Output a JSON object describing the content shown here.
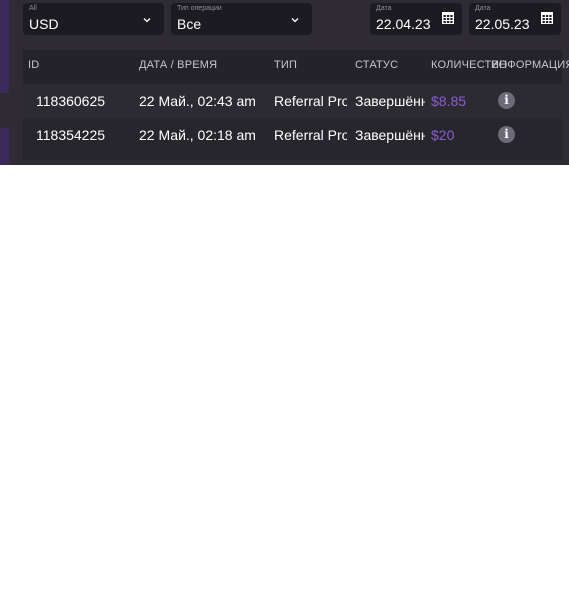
{
  "filters": {
    "currency": {
      "label": "All",
      "value": "USD"
    },
    "operation_type": {
      "label": "Тип операции",
      "value": "Все"
    },
    "date_from": {
      "label": "Дата",
      "value": "22.04.23"
    },
    "date_to": {
      "label": "Дата",
      "value": "22.05.23"
    }
  },
  "table": {
    "columns": [
      "ID",
      "ДАТА / ВРЕМЯ",
      "ТИП",
      "СТАТУС",
      "КОЛИЧЕСТВО",
      "ИНФОРМАЦИЯ"
    ],
    "rows": [
      {
        "id": "118360625",
        "datetime": "22 Май., 02:43 am",
        "type": "Referral Pro...",
        "status": "Завершённ...",
        "amount": "$8.85",
        "info_icon": "info-icon"
      },
      {
        "id": "118354225",
        "datetime": "22 Май., 02:18 am",
        "type": "Referral Pro...",
        "status": "Завершённ...",
        "amount": "$20",
        "info_icon": "info-icon"
      }
    ]
  },
  "colors": {
    "panel_bg": "#2e2b34",
    "field_bg": "#1d1b22",
    "amount_accent": "#8b5cd6",
    "edge_accent": "#3c2a5a"
  }
}
